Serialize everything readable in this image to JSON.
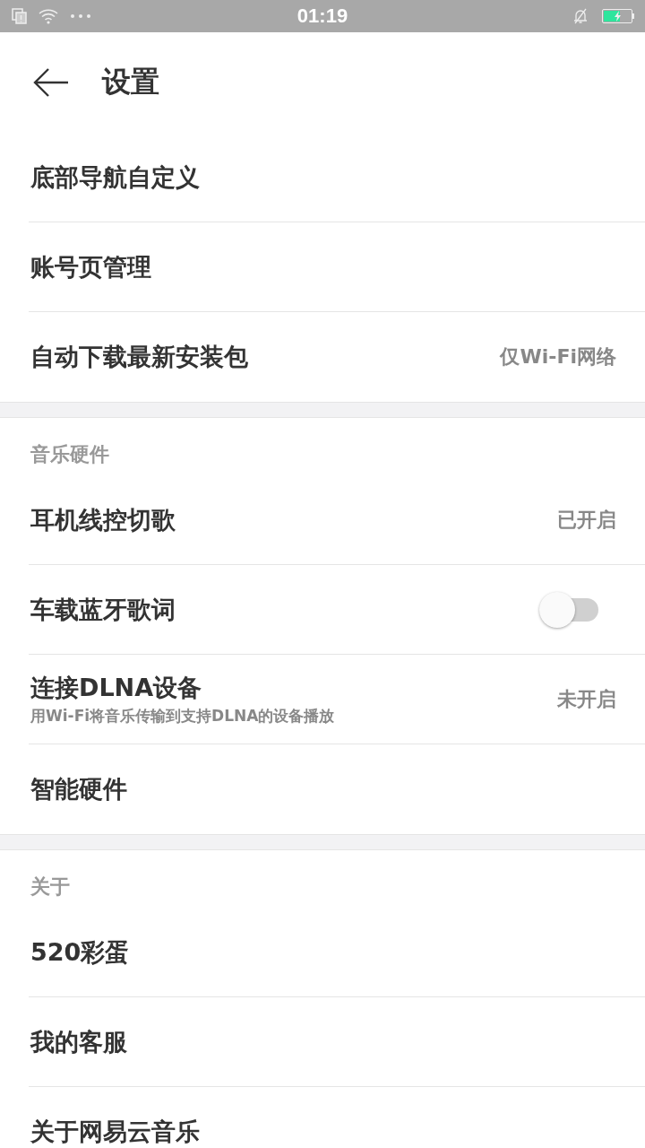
{
  "status_bar": {
    "time": "01:19"
  },
  "header": {
    "title": "设置"
  },
  "sections": [
    {
      "rows": [
        {
          "kind": "plain",
          "label": "底部导航自定义"
        },
        {
          "kind": "plain",
          "label": "账号页管理"
        },
        {
          "kind": "value",
          "label": "自动下载最新安装包",
          "value": "仅Wi-Fi网络"
        }
      ]
    },
    {
      "title": "音乐硬件",
      "rows": [
        {
          "kind": "value",
          "label": "耳机线控切歌",
          "value": "已开启"
        },
        {
          "kind": "toggle",
          "label": "车载蓝牙歌词",
          "on": false
        },
        {
          "kind": "value",
          "label": "连接DLNA设备",
          "subtitle": "用Wi-Fi将音乐传输到支持DLNA的设备播放",
          "value": "未开启"
        },
        {
          "kind": "plain",
          "label": "智能硬件"
        }
      ]
    },
    {
      "title": "关于",
      "rows": [
        {
          "kind": "plain",
          "label": "520彩蛋"
        },
        {
          "kind": "plain",
          "label": "我的客服"
        },
        {
          "kind": "plain",
          "label": "关于网易云音乐"
        }
      ]
    }
  ]
}
